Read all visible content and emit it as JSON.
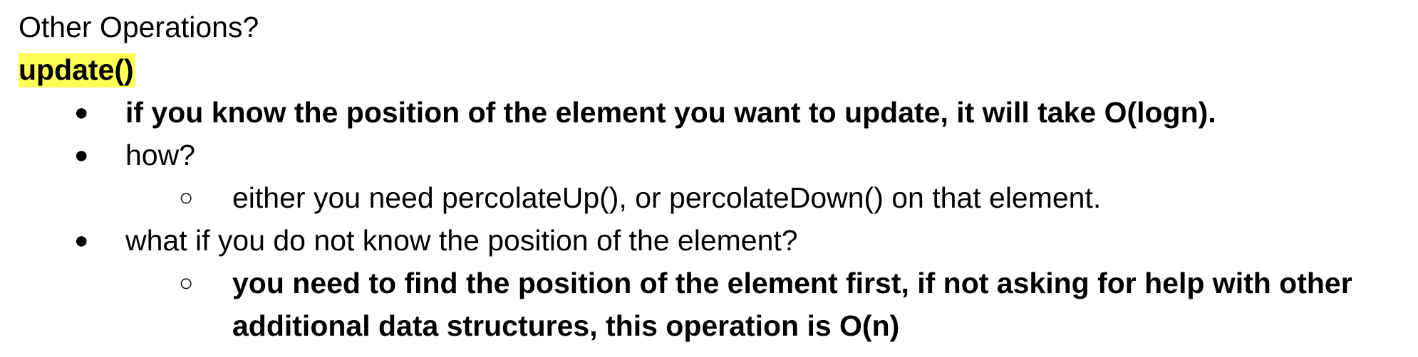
{
  "document": {
    "heading": "Other Operations?",
    "subheading": "update()",
    "highlight_color": "#ffff55",
    "bullets": [
      {
        "text": "if you know the position of the element you want to update, it will take O(logn).",
        "bold": true
      },
      {
        "text": "how?",
        "bold": false,
        "children": [
          {
            "text": "either you need percolateUp(), or percolateDown() on that element.",
            "bold": false
          }
        ]
      },
      {
        "text": "what if you do not know the position of the element?",
        "bold": false,
        "children": [
          {
            "text": "you need to find the position of the element first, if not asking for help with other additional data structures, this operation is O(n)",
            "bold": true
          }
        ]
      }
    ],
    "markers": {
      "level1": "●",
      "level2": "○"
    }
  }
}
